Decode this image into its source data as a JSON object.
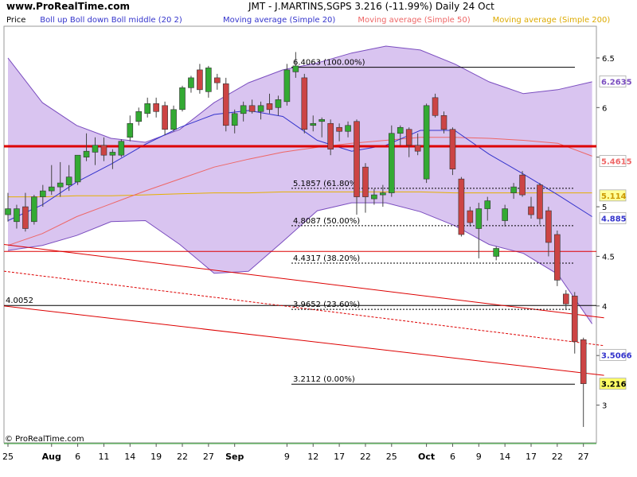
{
  "header": {
    "site": "www.ProRealTime.com",
    "title": "JMT - J.MARTINS,SGPS    3.216 (-11.99%)    Daily  24 Oct"
  },
  "legend": [
    {
      "text": "Price",
      "color": "#000000"
    },
    {
      "text": "Boll up Boll down Boll middle (20 2)",
      "color": "#3333cc"
    },
    {
      "text": "Moving average (Simple 20)",
      "color": "#3333cc"
    },
    {
      "text": "Moving average (Simple 50)",
      "color": "#ee6666"
    },
    {
      "text": "Moving average (Simple 200)",
      "color": "#ddaa00"
    }
  ],
  "footer_credit": "© ProRealTime.com",
  "colors": {
    "up": "#33aa33",
    "down": "#cc4444",
    "band_fill": "#d9c4f0",
    "band_line": "#7a4dbf",
    "ma20": "#3333cc",
    "ma50": "#ee6666",
    "ma200": "#e6b000",
    "support": "#dd0000"
  },
  "chart_data": {
    "type": "candlestick",
    "title": "JMT - J.MARTINS,SGPS 3.216 (-11.99%) Daily 24 Oct",
    "ylim": [
      2.62,
      6.82
    ],
    "y_ticks": [
      3,
      3.5,
      4,
      4.5,
      5,
      5.5,
      6,
      6.5
    ],
    "y_tick_labels": [
      "3",
      "",
      "4",
      "4.5",
      "5",
      "",
      "6",
      "6.5"
    ],
    "x_ticks": [
      {
        "label": "25",
        "index": 0
      },
      {
        "label": "Aug",
        "index": 5
      },
      {
        "label": "6",
        "index": 8
      },
      {
        "label": "11",
        "index": 11
      },
      {
        "label": "14",
        "index": 14
      },
      {
        "label": "19",
        "index": 17
      },
      {
        "label": "22",
        "index": 20
      },
      {
        "label": "27",
        "index": 23
      },
      {
        "label": "Sep",
        "index": 26
      },
      {
        "label": "9",
        "index": 32
      },
      {
        "label": "12",
        "index": 35
      },
      {
        "label": "17",
        "index": 38
      },
      {
        "label": "22",
        "index": 41
      },
      {
        "label": "25",
        "index": 44
      },
      {
        "label": "Oct",
        "index": 48
      },
      {
        "label": "6",
        "index": 51
      },
      {
        "label": "9",
        "index": 54
      },
      {
        "label": "14",
        "index": 57
      },
      {
        "label": "17",
        "index": 60
      },
      {
        "label": "22",
        "index": 63
      },
      {
        "label": "27",
        "index": 66
      }
    ],
    "x_slots": 68,
    "candles": [
      {
        "o": 4.92,
        "h": 5.14,
        "l": 4.85,
        "c": 4.98
      },
      {
        "o": 4.85,
        "h": 5.02,
        "l": 4.78,
        "c": 4.98
      },
      {
        "o": 5.0,
        "h": 5.14,
        "l": 4.75,
        "c": 4.78
      },
      {
        "o": 4.85,
        "h": 5.12,
        "l": 4.82,
        "c": 5.1
      },
      {
        "o": 5.1,
        "h": 5.22,
        "l": 5.0,
        "c": 5.16
      },
      {
        "o": 5.16,
        "h": 5.42,
        "l": 5.12,
        "c": 5.2
      },
      {
        "o": 5.2,
        "h": 5.45,
        "l": 5.1,
        "c": 5.24
      },
      {
        "o": 5.22,
        "h": 5.42,
        "l": 5.16,
        "c": 5.3
      },
      {
        "o": 5.25,
        "h": 5.52,
        "l": 5.22,
        "c": 5.52
      },
      {
        "o": 5.5,
        "h": 5.74,
        "l": 5.46,
        "c": 5.56
      },
      {
        "o": 5.55,
        "h": 5.7,
        "l": 5.42,
        "c": 5.62
      },
      {
        "o": 5.62,
        "h": 5.7,
        "l": 5.46,
        "c": 5.52
      },
      {
        "o": 5.52,
        "h": 5.58,
        "l": 5.38,
        "c": 5.55
      },
      {
        "o": 5.52,
        "h": 5.68,
        "l": 5.5,
        "c": 5.66
      },
      {
        "o": 5.7,
        "h": 5.92,
        "l": 5.66,
        "c": 5.84
      },
      {
        "o": 5.86,
        "h": 6.0,
        "l": 5.82,
        "c": 5.96
      },
      {
        "o": 5.94,
        "h": 6.1,
        "l": 5.9,
        "c": 6.04
      },
      {
        "o": 6.04,
        "h": 6.1,
        "l": 5.9,
        "c": 5.96
      },
      {
        "o": 6.02,
        "h": 6.06,
        "l": 5.72,
        "c": 5.78
      },
      {
        "o": 5.78,
        "h": 6.02,
        "l": 5.76,
        "c": 5.98
      },
      {
        "o": 5.98,
        "h": 6.22,
        "l": 5.96,
        "c": 6.2
      },
      {
        "o": 6.2,
        "h": 6.32,
        "l": 6.15,
        "c": 6.3
      },
      {
        "o": 6.38,
        "h": 6.44,
        "l": 6.14,
        "c": 6.18
      },
      {
        "o": 6.16,
        "h": 6.42,
        "l": 6.1,
        "c": 6.4
      },
      {
        "o": 6.3,
        "h": 6.34,
        "l": 6.18,
        "c": 6.25
      },
      {
        "o": 6.24,
        "h": 6.3,
        "l": 5.76,
        "c": 5.82
      },
      {
        "o": 5.82,
        "h": 5.98,
        "l": 5.74,
        "c": 5.94
      },
      {
        "o": 5.94,
        "h": 6.06,
        "l": 5.86,
        "c": 6.02
      },
      {
        "o": 6.02,
        "h": 6.08,
        "l": 5.94,
        "c": 5.96
      },
      {
        "o": 5.96,
        "h": 6.06,
        "l": 5.88,
        "c": 6.02
      },
      {
        "o": 6.04,
        "h": 6.14,
        "l": 5.94,
        "c": 5.98
      },
      {
        "o": 6.0,
        "h": 6.12,
        "l": 5.92,
        "c": 6.08
      },
      {
        "o": 6.06,
        "h": 6.44,
        "l": 6.02,
        "c": 6.38
      },
      {
        "o": 6.36,
        "h": 6.56,
        "l": 6.3,
        "c": 6.42
      },
      {
        "o": 6.3,
        "h": 6.34,
        "l": 5.74,
        "c": 5.78
      },
      {
        "o": 5.82,
        "h": 5.92,
        "l": 5.76,
        "c": 5.84
      },
      {
        "o": 5.86,
        "h": 5.9,
        "l": 5.7,
        "c": 5.88
      },
      {
        "o": 5.84,
        "h": 5.88,
        "l": 5.52,
        "c": 5.58
      },
      {
        "o": 5.8,
        "h": 5.84,
        "l": 5.66,
        "c": 5.76
      },
      {
        "o": 5.76,
        "h": 5.86,
        "l": 5.7,
        "c": 5.82
      },
      {
        "o": 5.86,
        "h": 5.88,
        "l": 4.92,
        "c": 5.1
      },
      {
        "o": 5.4,
        "h": 5.44,
        "l": 4.94,
        "c": 5.1
      },
      {
        "o": 5.08,
        "h": 5.18,
        "l": 5.02,
        "c": 5.12
      },
      {
        "o": 5.12,
        "h": 5.22,
        "l": 5.0,
        "c": 5.14
      },
      {
        "o": 5.14,
        "h": 5.82,
        "l": 5.1,
        "c": 5.74
      },
      {
        "o": 5.74,
        "h": 5.82,
        "l": 5.62,
        "c": 5.8
      },
      {
        "o": 5.78,
        "h": 5.8,
        "l": 5.5,
        "c": 5.62
      },
      {
        "o": 5.62,
        "h": 5.74,
        "l": 5.52,
        "c": 5.56
      },
      {
        "o": 5.28,
        "h": 6.04,
        "l": 5.24,
        "c": 6.02
      },
      {
        "o": 6.1,
        "h": 6.14,
        "l": 5.9,
        "c": 5.92
      },
      {
        "o": 5.92,
        "h": 5.96,
        "l": 5.74,
        "c": 5.78
      },
      {
        "o": 5.78,
        "h": 5.8,
        "l": 5.32,
        "c": 5.38
      },
      {
        "o": 5.28,
        "h": 5.3,
        "l": 4.7,
        "c": 4.72
      },
      {
        "o": 4.96,
        "h": 5.0,
        "l": 4.8,
        "c": 4.84
      },
      {
        "o": 4.78,
        "h": 5.04,
        "l": 4.48,
        "c": 4.98
      },
      {
        "o": 4.98,
        "h": 5.1,
        "l": 4.86,
        "c": 5.06
      },
      {
        "o": 4.5,
        "h": 4.6,
        "l": 4.46,
        "c": 4.58
      },
      {
        "o": 4.86,
        "h": 5.02,
        "l": 4.8,
        "c": 4.98
      },
      {
        "o": 5.14,
        "h": 5.24,
        "l": 5.08,
        "c": 5.2
      },
      {
        "o": 5.32,
        "h": 5.36,
        "l": 5.1,
        "c": 5.12
      },
      {
        "o": 5.0,
        "h": 5.1,
        "l": 4.88,
        "c": 4.92
      },
      {
        "o": 5.22,
        "h": 5.24,
        "l": 4.82,
        "c": 4.88
      },
      {
        "o": 4.96,
        "h": 5.0,
        "l": 4.5,
        "c": 4.64
      },
      {
        "o": 4.72,
        "h": 4.76,
        "l": 4.2,
        "c": 4.26
      },
      {
        "o": 4.12,
        "h": 4.16,
        "l": 3.96,
        "c": 4.02
      },
      {
        "o": 4.1,
        "h": 4.14,
        "l": 3.52,
        "c": 3.64
      },
      {
        "o": 3.66,
        "h": 3.68,
        "l": 2.78,
        "c": 3.216
      }
    ],
    "bollinger_upper": [
      6.5,
      6.05,
      5.82,
      5.69,
      5.65,
      5.78,
      6.05,
      6.25,
      6.38,
      6.45,
      6.55,
      6.62,
      6.58,
      6.44,
      6.26,
      6.14,
      6.18,
      6.26
    ],
    "bollinger_lower": [
      4.56,
      4.61,
      4.71,
      4.85,
      4.86,
      4.62,
      4.33,
      4.35,
      4.65,
      4.96,
      5.04,
      5.04,
      4.95,
      4.81,
      4.62,
      4.53,
      4.32,
      3.82
    ],
    "ma20": [
      4.86,
      5.02,
      5.25,
      5.43,
      5.63,
      5.8,
      5.93,
      5.97,
      5.91,
      5.67,
      5.56,
      5.62,
      5.77,
      5.77,
      5.53,
      5.33,
      5.12,
      4.9
    ],
    "ma50": [
      4.61,
      4.73,
      4.9,
      5.03,
      5.16,
      5.28,
      5.4,
      5.48,
      5.55,
      5.6,
      5.64,
      5.67,
      5.7,
      5.7,
      5.69,
      5.67,
      5.64,
      5.51
    ],
    "ma200": [
      5.1,
      5.1,
      5.11,
      5.11,
      5.12,
      5.13,
      5.14,
      5.14,
      5.15,
      5.15,
      5.15,
      5.15,
      5.15,
      5.14,
      5.14,
      5.14,
      5.14,
      5.14
    ],
    "fibonacci": [
      {
        "label": "6.4063 (100.00%)",
        "value": 6.4063,
        "style": "solid"
      },
      {
        "label": "5.1857 (61.80%)",
        "value": 5.1857,
        "style": "dashed"
      },
      {
        "label": "4.8087 (50.00%)",
        "value": 4.8087,
        "style": "dashed"
      },
      {
        "label": "4.4317 (38.20%)",
        "value": 4.4317,
        "style": "dashed"
      },
      {
        "label": "3.9652 (23.60%)",
        "value": 3.9652,
        "style": "dashed"
      },
      {
        "label": "3.2112 (0.00%)",
        "value": 3.2112,
        "style": "solid"
      }
    ],
    "horizontal_lines": [
      {
        "value": 5.61,
        "color": "#dd0000",
        "width": 3
      },
      {
        "value": 4.55,
        "color": "#dd0000",
        "width": 1
      },
      {
        "value": 4.005,
        "color": "#000000",
        "width": 1,
        "label": "4.0052"
      }
    ],
    "trendlines": [
      {
        "from": [
          0,
          4.62
        ],
        "to": [
          68,
          3.88
        ],
        "color": "#dd0000",
        "dash": false
      },
      {
        "from": [
          0,
          4.35
        ],
        "to": [
          68,
          3.6
        ],
        "color": "#dd0000",
        "dash": true
      },
      {
        "from": [
          0,
          4.0
        ],
        "to": [
          68,
          3.3
        ],
        "color": "#dd0000",
        "dash": false
      }
    ],
    "right_labels": [
      {
        "text": "6.2635",
        "value": 6.2635,
        "color": "#7a4dbf",
        "bg": "#ffffff"
      },
      {
        "text": "5.4615",
        "value": 5.4615,
        "color": "#ee6666",
        "bg": "#ffffff"
      },
      {
        "text": "5.114",
        "value": 5.114,
        "color": "#cc9900",
        "bg": "#ffff99"
      },
      {
        "text": "4.885",
        "value": 4.885,
        "color": "#3333cc",
        "bg": "#ffffff"
      },
      {
        "text": "3.5066",
        "value": 3.5066,
        "color": "#3333cc",
        "bg": "#ffffff"
      },
      {
        "text": "3.216",
        "value": 3.216,
        "color": "#000000",
        "bg": "#ffff66"
      }
    ]
  }
}
